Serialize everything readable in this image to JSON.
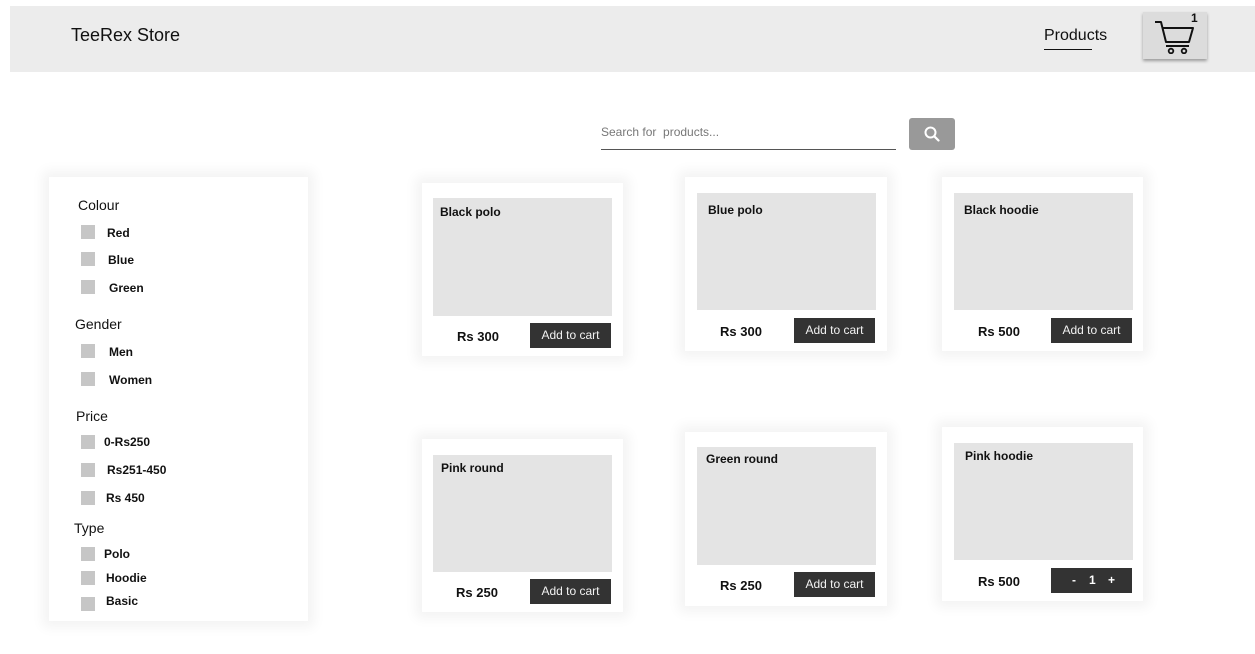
{
  "header": {
    "brand": "TeeRex Store",
    "nav_products": "Products",
    "cart_count": "1"
  },
  "search": {
    "placeholder": "Search for  products..."
  },
  "filters": {
    "colour": {
      "heading": "Colour",
      "options": [
        "Red",
        "Blue",
        "Green"
      ]
    },
    "gender": {
      "heading": "Gender",
      "options": [
        "Men",
        "Women"
      ]
    },
    "price": {
      "heading": "Price",
      "options": [
        "0-Rs250",
        "Rs251-450",
        "Rs 450"
      ]
    },
    "type": {
      "heading": "Type",
      "options": [
        "Polo",
        "Hoodie",
        "Basic"
      ]
    }
  },
  "products": [
    {
      "name": "Black polo",
      "price": "Rs 300",
      "action": "Add to cart"
    },
    {
      "name": "Blue polo",
      "price": "Rs 300",
      "action": "Add to cart"
    },
    {
      "name": "Black hoodie",
      "price": "Rs 500",
      "action": "Add to cart"
    },
    {
      "name": "Pink round",
      "price": "Rs 250",
      "action": "Add to cart"
    },
    {
      "name": "Green round",
      "price": "Rs 250",
      "action": "Add to cart"
    },
    {
      "name": "Pink hoodie",
      "price": "Rs 500",
      "quantity": {
        "minus": "-",
        "value": "1",
        "plus": "+"
      }
    }
  ],
  "colors": {
    "header_bg": "#ececec",
    "button_dark": "#333333",
    "search_button": "#999999",
    "image_placeholder": "#e4e4e4",
    "checkbox": "#c6c6c6"
  },
  "icons": {
    "cart": "cart-icon",
    "search": "search-icon"
  }
}
